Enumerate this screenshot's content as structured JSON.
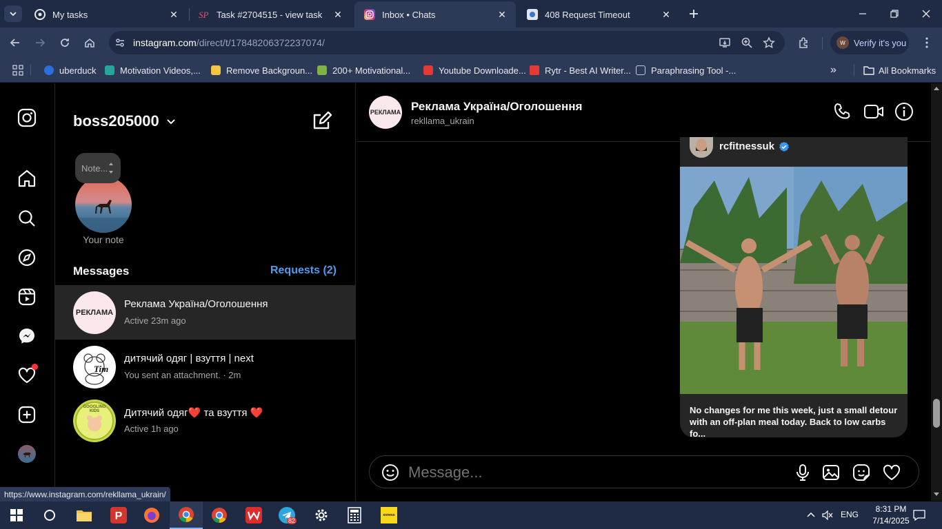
{
  "browser": {
    "tabs": [
      {
        "title": "My tasks",
        "icon": "my-tasks-favicon"
      },
      {
        "title": "Task #2704515 - view task",
        "icon": "sp-favicon"
      },
      {
        "title": "Inbox • Chats",
        "icon": "instagram-favicon",
        "active": true
      },
      {
        "title": "408 Request Timeout",
        "icon": "timeout-favicon"
      }
    ],
    "url_host": "instagram.com",
    "url_path": "/direct/t/17848206372237074/",
    "verify_label": "Verify it's you",
    "bookmarks": [
      "uberduck",
      "Motivation Videos,...",
      "Remove Backgroun...",
      "200+ Motivational...",
      "Youtube Downloade...",
      "Rytr - Best AI Writer...",
      "Paraphrasing Tool -..."
    ],
    "all_bookmarks": "All Bookmarks",
    "status_url": "https://www.instagram.com/rekllama_ukrain/"
  },
  "inbox": {
    "username": "boss205000",
    "note_placeholder": "Note...",
    "note_label": "Your note",
    "messages_title": "Messages",
    "requests_label": "Requests (2)",
    "threads": [
      {
        "name": "Реклама Україна/Оголошення",
        "status": "Active 23m ago",
        "avatar_text": "РЕКЛАМА"
      },
      {
        "name": "дитячий одяг | взуття | next",
        "status": "You sent an attachment. · 2m",
        "avatar_text": "Tim"
      },
      {
        "name": "Дитячий одяг❤️ та взуття ❤️",
        "status": "Active 1h ago",
        "avatar_text": "GOOGLING KIDS"
      }
    ]
  },
  "chat": {
    "name": "Реклама Україна/Оголошення",
    "handle": "rekllama_ukrain",
    "avatar_text": "РЕКЛАМА",
    "post": {
      "user": "rcfitnessuk",
      "caption": "No changes for me this week, just a small detour with an off-plan meal today. Back to low carbs fo..."
    },
    "composer_placeholder": "Message..."
  },
  "taskbar": {
    "lang": "ENG",
    "time": "8:31 PM",
    "date": "7/14/2025",
    "telegram_badge": "82",
    "exness_label": "exness"
  },
  "colors": {
    "link_blue": "#4c9ded",
    "browser_frame": "#2d3a57",
    "selected_thread": "#262626"
  }
}
